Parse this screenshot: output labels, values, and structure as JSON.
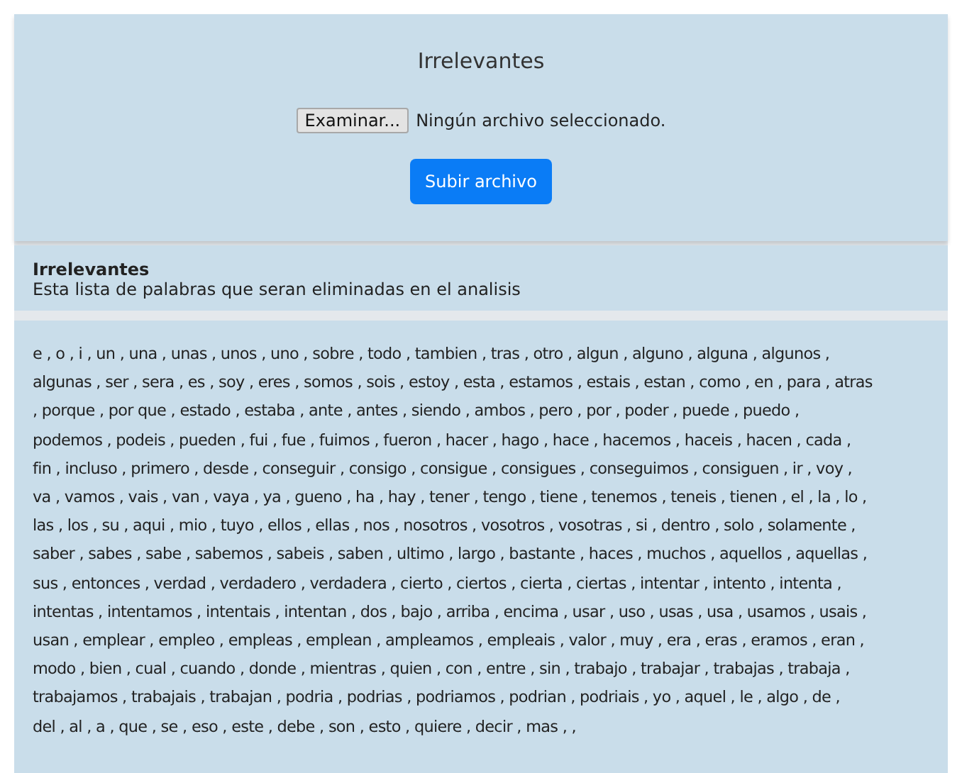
{
  "upload_panel": {
    "title": "Irrelevantes",
    "browse_button": "Examinar...",
    "file_status": "Ningún archivo seleccionado.",
    "submit_button": "Subir archivo"
  },
  "info": {
    "heading": "Irrelevantes",
    "description": "Esta lista de palabras que seran eliminadas en el analisis"
  },
  "word_list": [
    "e , o , i , un , una , unas , unos , uno , sobre , todo , tambien , tras , otro , algun , alguno , alguna , algunos ,",
    "algunas , ser , sera , es , soy , eres , somos , sois , estoy , esta , estamos , estais , estan , como , en , para , atras",
    ", porque , por que , estado , estaba , ante , antes , siendo , ambos , pero , por , poder , puede , puedo ,",
    "podemos , podeis , pueden , fui , fue , fuimos , fueron , hacer , hago , hace , hacemos , haceis , hacen , cada ,",
    "fin , incluso , primero , desde , conseguir , consigo , consigue , consigues , conseguimos , consiguen , ir , voy ,",
    "va , vamos , vais , van , vaya , ya , gueno , ha , hay , tener , tengo , tiene , tenemos , teneis , tienen , el , la , lo ,",
    "las , los , su , aqui , mio , tuyo , ellos , ellas , nos , nosotros , vosotros , vosotras , si , dentro , solo , solamente ,",
    "saber , sabes , sabe , sabemos , sabeis , saben , ultimo , largo , bastante , haces , muchos , aquellos , aquellas ,",
    "sus , entonces , verdad , verdadero , verdadera , cierto , ciertos , cierta , ciertas , intentar , intento , intenta ,",
    "intentas , intentamos , intentais , intentan , dos , bajo , arriba , encima , usar , uso , usas , usa , usamos , usais ,",
    "usan , emplear , empleo , empleas , emplean , ampleamos , empleais , valor , muy , era , eras , eramos , eran ,",
    "modo , bien , cual , cuando , donde , mientras , quien , con , entre , sin , trabajo , trabajar , trabajas , trabaja ,",
    "trabajamos , trabajais , trabajan , podria , podrias , podriamos , podrian , podriais , yo , aquel , le , algo , de ,",
    "del , al , a , que , se , eso , este , debe , son , esto , quiere , decir , mas , ,"
  ]
}
